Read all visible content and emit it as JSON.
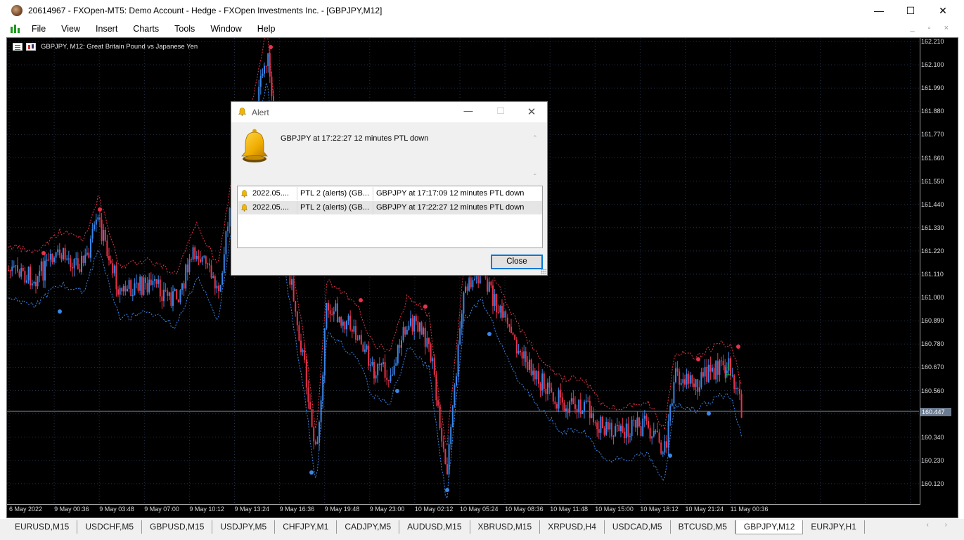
{
  "window": {
    "title": "20614967 - FXOpen-MT5: Demo Account - Hedge - FXOpen Investments Inc. - [GBPJPY,M12]",
    "minimize_glyph": "—",
    "maximize_glyph": "☐",
    "close_glyph": "✕"
  },
  "menu": {
    "items": [
      "File",
      "View",
      "Insert",
      "Charts",
      "Tools",
      "Window",
      "Help"
    ],
    "mdi_controls": "_ ▫ ×"
  },
  "chart": {
    "symbol_label": "GBPJPY, M12:  Great Britain Pound vs Japanese Yen",
    "current_price": "160.447",
    "price_ticks": [
      "162.210",
      "162.100",
      "161.990",
      "161.880",
      "161.770",
      "161.660",
      "161.550",
      "161.440",
      "161.330",
      "161.220",
      "161.110",
      "161.000",
      "160.890",
      "160.780",
      "160.670",
      "160.560",
      "160.340",
      "160.230",
      "160.120"
    ],
    "time_ticks": [
      "6 May 2022",
      "9 May 00:36",
      "9 May 03:48",
      "9 May 07:00",
      "9 May 10:12",
      "9 May 13:24",
      "9 May 16:36",
      "9 May 19:48",
      "9 May 23:00",
      "10 May 02:12",
      "10 May 05:24",
      "10 May 08:36",
      "10 May 11:48",
      "10 May 15:00",
      "10 May 18:12",
      "10 May 21:24",
      "11 May 00:36"
    ],
    "colors": {
      "background": "#000000",
      "bull": "#3a86e8",
      "bear": "#e8334a",
      "grid": "#23324a",
      "bid_line": "#7f8fa6"
    }
  },
  "tabs": {
    "items": [
      "EURUSD,M15",
      "USDCHF,M5",
      "GBPUSD,M15",
      "USDJPY,M5",
      "CHFJPY,M1",
      "CADJPY,M5",
      "AUDUSD,M15",
      "XBRUSD,M15",
      "XRPUSD,H4",
      "USDCAD,M5",
      "BTCUSD,M5",
      "GBPJPY,M12",
      "EURJPY,H1"
    ],
    "active": "GBPJPY,M12",
    "scroll": "‹ ›"
  },
  "alert": {
    "title": "Alert",
    "message": "GBPJPY at 17:22:27 12 minutes PTL  down",
    "scroll_up": "⌃",
    "scroll_down": "⌄",
    "rows": [
      {
        "time": "2022.05....",
        "source": "PTL 2 (alerts) (GB...",
        "message": "GBPJPY at 17:17:09 12 minutes PTL  down"
      },
      {
        "time": "2022.05....",
        "source": "PTL 2 (alerts) (GB...",
        "message": "GBPJPY at 17:22:27 12 minutes PTL  down"
      }
    ],
    "close_label": "Close",
    "minimize_glyph": "—",
    "maximize_glyph": "☐",
    "close_glyph": "✕"
  }
}
